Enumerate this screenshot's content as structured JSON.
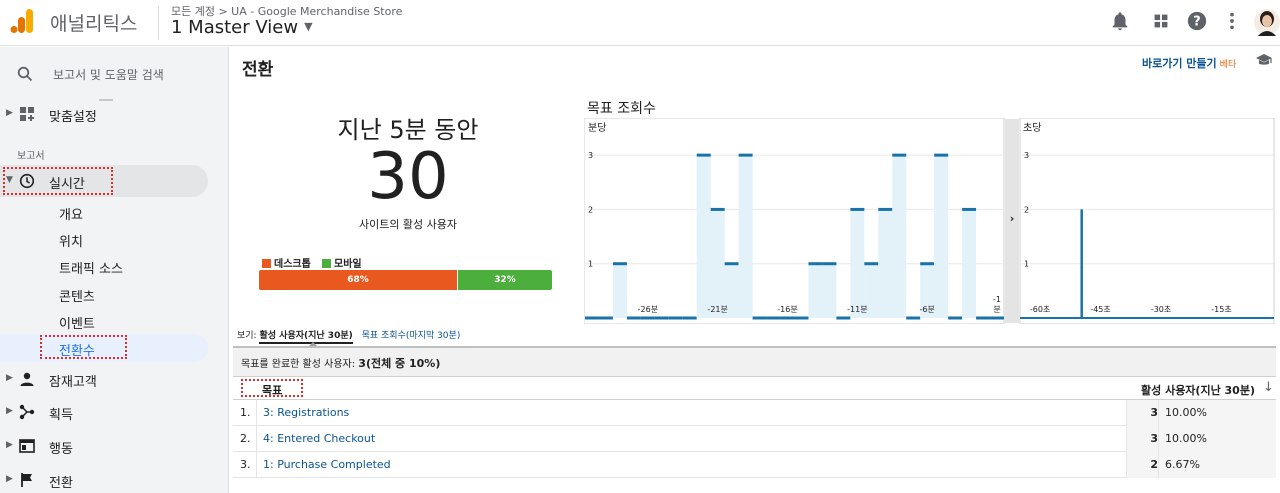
{
  "header": {
    "app_name": "애널리틱스",
    "breadcrumb": "모든 계정 > UA - Google Merchandise Store",
    "view_name": "1 Master View",
    "icons": [
      "notifications-icon",
      "apps-grid-icon",
      "help-icon",
      "more-vert-icon",
      "avatar"
    ]
  },
  "sidebar": {
    "search_placeholder": "보고서 및 도움말 검색",
    "customization_label": "맞춤설정",
    "section_reports": "보고서",
    "realtime_label": "실시간",
    "realtime_items": [
      "개요",
      "위치",
      "트래픽 소스",
      "콘텐츠",
      "이벤트",
      "전환수"
    ],
    "other_items": [
      "잠재고객",
      "획득",
      "행동",
      "전환"
    ]
  },
  "page": {
    "title": "전환",
    "shortcut_label": "바로가기 만들기",
    "beta_label": "베타"
  },
  "realtime_summary": {
    "period_label": "지난 5분 동안",
    "active_users": "30",
    "active_users_label": "사이트의 활성 사용자",
    "devices": [
      {
        "name": "데스크톱",
        "percent": 68,
        "label": "68%",
        "color": "#e8581f"
      },
      {
        "name": "모바일",
        "percent": 32,
        "label": "32%",
        "color": "#4cae3c"
      }
    ]
  },
  "view_options": {
    "label": "보기:",
    "option_active": "활성 사용자(지난 30분)",
    "option_goal_views": "목표 조회수(마지막 30분)"
  },
  "chart_data": [
    {
      "type": "bar",
      "title": "목표 조회수",
      "panel_label": "분당",
      "ylim": [
        0,
        3.5
      ],
      "yticks": [
        "1",
        "2",
        "3"
      ],
      "xtick_labels": [
        "-26분",
        "-21분",
        "-16분",
        "-11분",
        "-6분",
        "-1분"
      ],
      "x": [
        -30,
        -29,
        -28,
        -27,
        -26,
        -25,
        -24,
        -23,
        -22,
        -21,
        -20,
        -19,
        -18,
        -17,
        -16,
        -15,
        -14,
        -13,
        -12,
        -11,
        -10,
        -9,
        -8,
        -7,
        -6,
        -5,
        -4,
        -3,
        -2,
        -1
      ],
      "values": [
        0,
        0,
        1,
        0,
        0,
        0,
        0,
        0,
        3,
        2,
        1,
        3,
        0,
        0,
        0,
        0,
        1,
        1,
        0,
        2,
        1,
        2,
        3,
        0,
        1,
        3,
        0,
        2,
        0,
        0
      ],
      "color": "#1a73a8"
    },
    {
      "type": "bar",
      "panel_label": "초당",
      "ylim": [
        0,
        3.5
      ],
      "yticks": [
        "1",
        "2",
        "3"
      ],
      "xtick_labels": [
        "-60초",
        "-45초",
        "-30초",
        "-15초"
      ],
      "x": [
        -60,
        -45,
        -30,
        -15
      ],
      "spikes": [
        {
          "x": -48,
          "value": 2
        }
      ],
      "color": "#1a73a8"
    }
  ],
  "goals_table": {
    "summary_label": "목표를 완료한 활성 사용자:",
    "summary_value": "3(전체 중 10%)",
    "col_goal": "목표",
    "col_users": "활성 사용자(지난 30분)",
    "rows": [
      {
        "idx": "1.",
        "goal": "3: Registrations",
        "users": "3",
        "pct": "10.00%"
      },
      {
        "idx": "2.",
        "goal": "4: Entered Checkout",
        "users": "3",
        "pct": "10.00%"
      },
      {
        "idx": "3.",
        "goal": "1: Purchase Completed",
        "users": "2",
        "pct": "6.67%"
      }
    ]
  }
}
